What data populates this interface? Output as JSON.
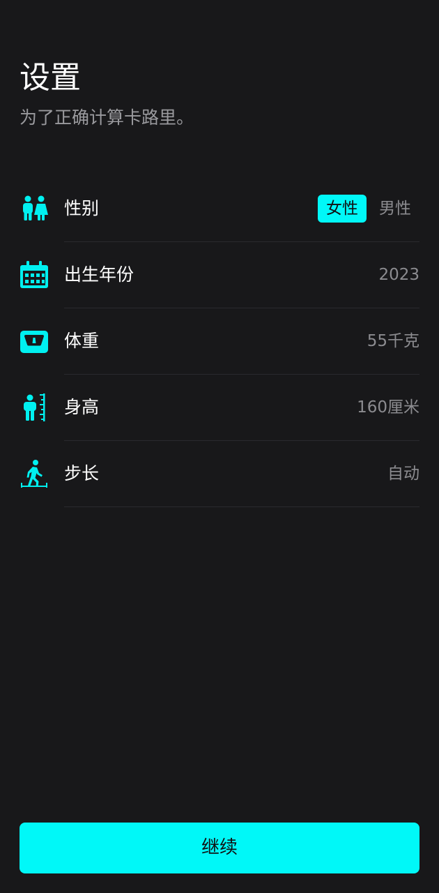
{
  "header": {
    "title": "设置",
    "subtitle": "为了正确计算卡路里。"
  },
  "settings": {
    "gender": {
      "label": "性别",
      "icon": "gender-couple-icon",
      "options": [
        "女性",
        "男性"
      ],
      "selected": "女性"
    },
    "birth_year": {
      "label": "出生年份",
      "icon": "calendar-icon",
      "value": "2023"
    },
    "weight": {
      "label": "体重",
      "icon": "scale-icon",
      "value": "55千克"
    },
    "height": {
      "label": "身高",
      "icon": "height-ruler-icon",
      "value": "160厘米"
    },
    "stride": {
      "label": "步长",
      "icon": "walking-stride-icon",
      "value": "自动"
    }
  },
  "footer": {
    "continue_label": "继续"
  },
  "colors": {
    "accent": "#00f8f8",
    "background": "#18181a",
    "muted_text": "#8c8c90",
    "divider": "#2a2a2e"
  }
}
